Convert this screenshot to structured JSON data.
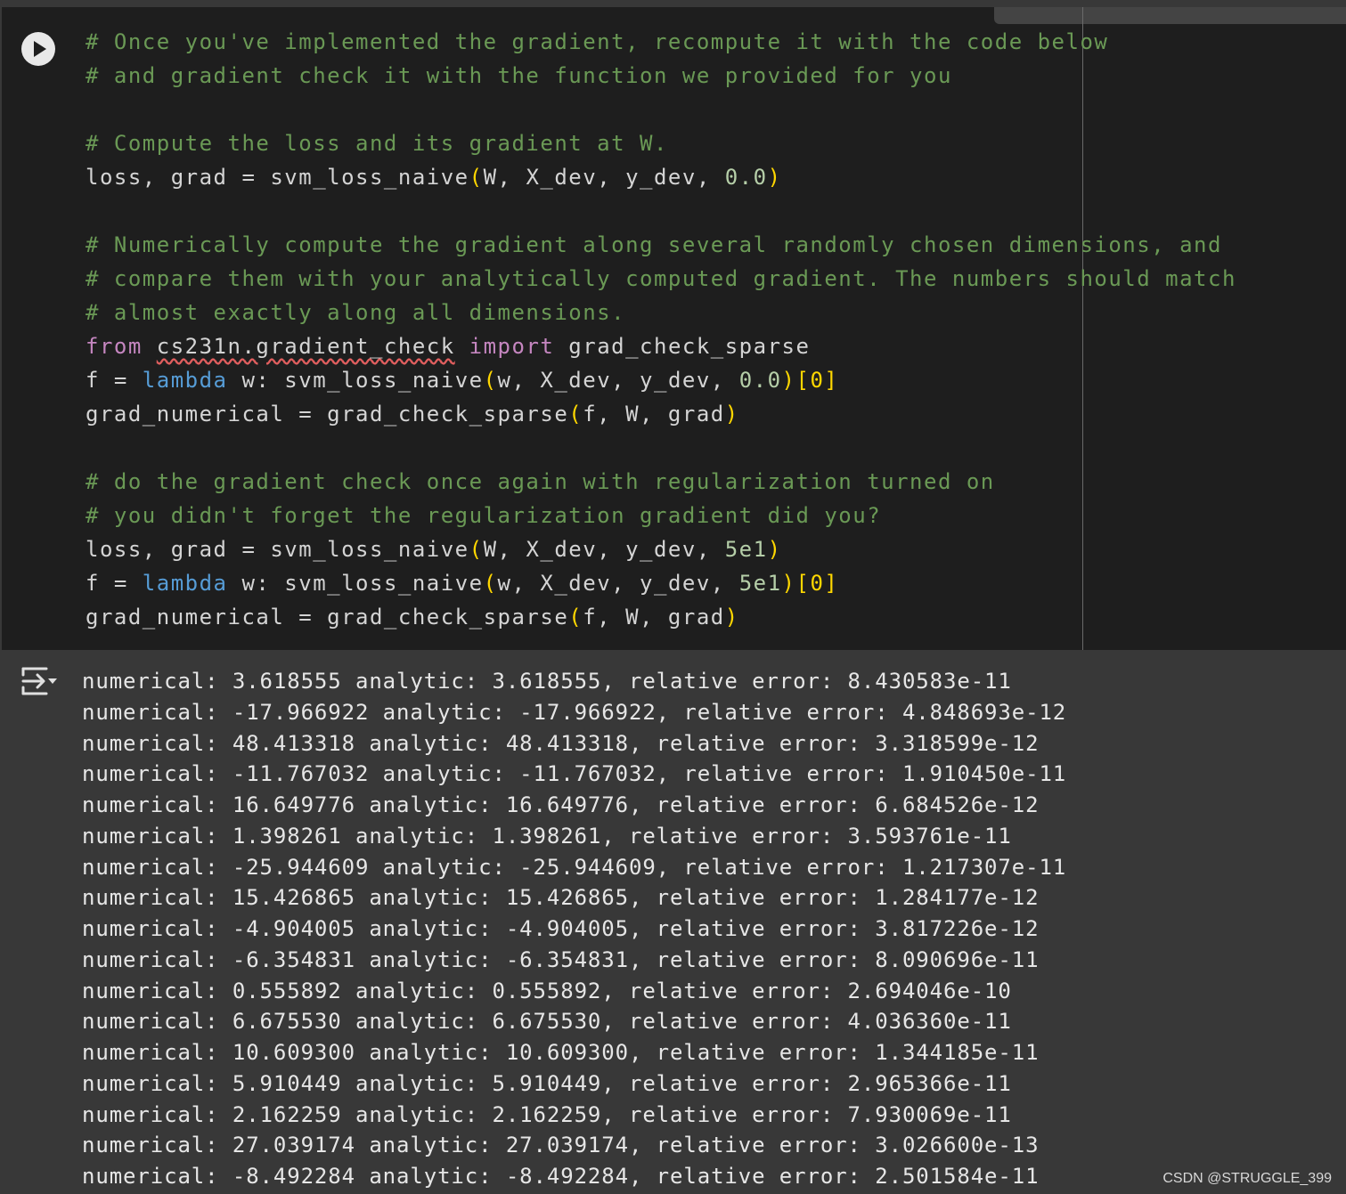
{
  "cell": {
    "run_label": "",
    "lines": [
      {
        "segments": [
          {
            "t": "# Once you've implemented the gradient, recompute it with the code below",
            "c": "c"
          }
        ]
      },
      {
        "segments": [
          {
            "t": "# and gradient check it with the function we provided for you",
            "c": "c"
          }
        ]
      },
      {
        "segments": []
      },
      {
        "segments": [
          {
            "t": "# Compute the loss and its gradient at W.",
            "c": "c"
          }
        ]
      },
      {
        "segments": [
          {
            "t": "loss, grad = svm_loss_naive",
            "c": "m"
          },
          {
            "t": "(",
            "c": "p"
          },
          {
            "t": "W, X_dev, y_dev, ",
            "c": "m"
          },
          {
            "t": "0.0",
            "c": "n"
          },
          {
            "t": ")",
            "c": "p"
          }
        ]
      },
      {
        "segments": []
      },
      {
        "segments": [
          {
            "t": "# Numerically compute the gradient along several randomly chosen dimensions, and",
            "c": "c"
          }
        ]
      },
      {
        "segments": [
          {
            "t": "# compare them with your analytically computed gradient. The numbers should match",
            "c": "c"
          }
        ]
      },
      {
        "segments": [
          {
            "t": "# almost exactly along all dimensions.",
            "c": "c"
          }
        ]
      },
      {
        "segments": [
          {
            "t": "from",
            "c": "k"
          },
          {
            "t": " ",
            "c": "m"
          },
          {
            "t": "cs231n.gradient_check",
            "c": "m squig"
          },
          {
            "t": " ",
            "c": "m"
          },
          {
            "t": "import",
            "c": "k"
          },
          {
            "t": " grad_check_sparse",
            "c": "m"
          }
        ]
      },
      {
        "segments": [
          {
            "t": "f = ",
            "c": "m"
          },
          {
            "t": "lambda",
            "c": "b"
          },
          {
            "t": " w: svm_loss_naive",
            "c": "m"
          },
          {
            "t": "(",
            "c": "p"
          },
          {
            "t": "w, X_dev, y_dev, ",
            "c": "m"
          },
          {
            "t": "0.0",
            "c": "n"
          },
          {
            "t": ")[0]",
            "c": "p"
          }
        ]
      },
      {
        "segments": [
          {
            "t": "grad_numerical = grad_check_sparse",
            "c": "m"
          },
          {
            "t": "(",
            "c": "p"
          },
          {
            "t": "f, W, grad",
            "c": "m"
          },
          {
            "t": ")",
            "c": "p"
          }
        ]
      },
      {
        "segments": []
      },
      {
        "segments": [
          {
            "t": "# do the gradient check once again with regularization turned on",
            "c": "c"
          }
        ]
      },
      {
        "segments": [
          {
            "t": "# you didn't forget the regularization gradient did you?",
            "c": "c"
          }
        ]
      },
      {
        "segments": [
          {
            "t": "loss, grad = svm_loss_naive",
            "c": "m"
          },
          {
            "t": "(",
            "c": "p"
          },
          {
            "t": "W, X_dev, y_dev, ",
            "c": "m"
          },
          {
            "t": "5e1",
            "c": "n"
          },
          {
            "t": ")",
            "c": "p"
          }
        ]
      },
      {
        "segments": [
          {
            "t": "f = ",
            "c": "m"
          },
          {
            "t": "lambda",
            "c": "b"
          },
          {
            "t": " w: svm_loss_naive",
            "c": "m"
          },
          {
            "t": "(",
            "c": "p"
          },
          {
            "t": "w, X_dev, y_dev, ",
            "c": "m"
          },
          {
            "t": "5e1",
            "c": "n"
          },
          {
            "t": ")[0]",
            "c": "p"
          }
        ]
      },
      {
        "segments": [
          {
            "t": "grad_numerical = grad_check_sparse",
            "c": "m"
          },
          {
            "t": "(",
            "c": "p"
          },
          {
            "t": "f, W, grad",
            "c": "m"
          },
          {
            "t": ")",
            "c": "p"
          }
        ]
      }
    ]
  },
  "output": {
    "lines": [
      "numerical: 3.618555 analytic: 3.618555, relative error: 8.430583e-11",
      "numerical: -17.966922 analytic: -17.966922, relative error: 4.848693e-12",
      "numerical: 48.413318 analytic: 48.413318, relative error: 3.318599e-12",
      "numerical: -11.767032 analytic: -11.767032, relative error: 1.910450e-11",
      "numerical: 16.649776 analytic: 16.649776, relative error: 6.684526e-12",
      "numerical: 1.398261 analytic: 1.398261, relative error: 3.593761e-11",
      "numerical: -25.944609 analytic: -25.944609, relative error: 1.217307e-11",
      "numerical: 15.426865 analytic: 15.426865, relative error: 1.284177e-12",
      "numerical: -4.904005 analytic: -4.904005, relative error: 3.817226e-12",
      "numerical: -6.354831 analytic: -6.354831, relative error: 8.090696e-11",
      "numerical: 0.555892 analytic: 0.555892, relative error: 2.694046e-10",
      "numerical: 6.675530 analytic: 6.675530, relative error: 4.036360e-11",
      "numerical: 10.609300 analytic: 10.609300, relative error: 1.344185e-11",
      "numerical: 5.910449 analytic: 5.910449, relative error: 2.965366e-11",
      "numerical: 2.162259 analytic: 2.162259, relative error: 7.930069e-11",
      "numerical: 27.039174 analytic: 27.039174, relative error: 3.026600e-13",
      "numerical: -8.492284 analytic: -8.492284, relative error: 2.501584e-11"
    ]
  },
  "watermark": "CSDN @STRUGGLE_399",
  "colors": {
    "comment": "#6a9955",
    "keyword": "#c586c0",
    "builtin": "#569cd6",
    "bracket": "#ffd700",
    "number": "#b5cea8"
  },
  "icons": {
    "run": "play-icon",
    "output": "output-toggle-icon"
  }
}
